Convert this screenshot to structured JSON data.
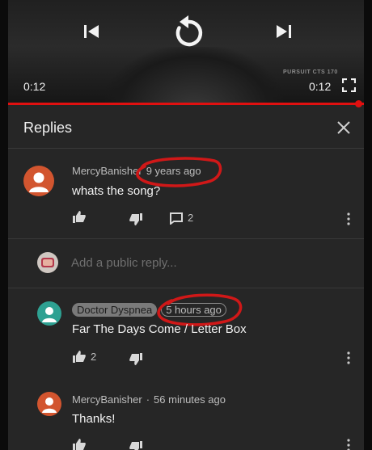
{
  "player": {
    "time_current": "0:12",
    "time_total": "0:12",
    "hud_text": "PURSUIT CTS\n170"
  },
  "panel": {
    "title": "Replies"
  },
  "comments": [
    {
      "author": "MercyBanisher",
      "separator": "·",
      "time": "9 years ago",
      "text": "whats the song?",
      "reply_count": "2"
    },
    {
      "author": "Doctor Dyspnea",
      "time": "5 hours ago",
      "text": "Far The Days Come / Letter Box",
      "like_count": "2"
    },
    {
      "author": "MercyBanisher",
      "separator": "·",
      "time": "56 minutes ago",
      "text": "Thanks!"
    }
  ],
  "reply_input": {
    "placeholder": "Add a public reply..."
  },
  "colors": {
    "progress": "#e01010",
    "annotation": "#d01818",
    "avatar_orange": "#d2552f",
    "avatar_teal": "#2ea192"
  }
}
